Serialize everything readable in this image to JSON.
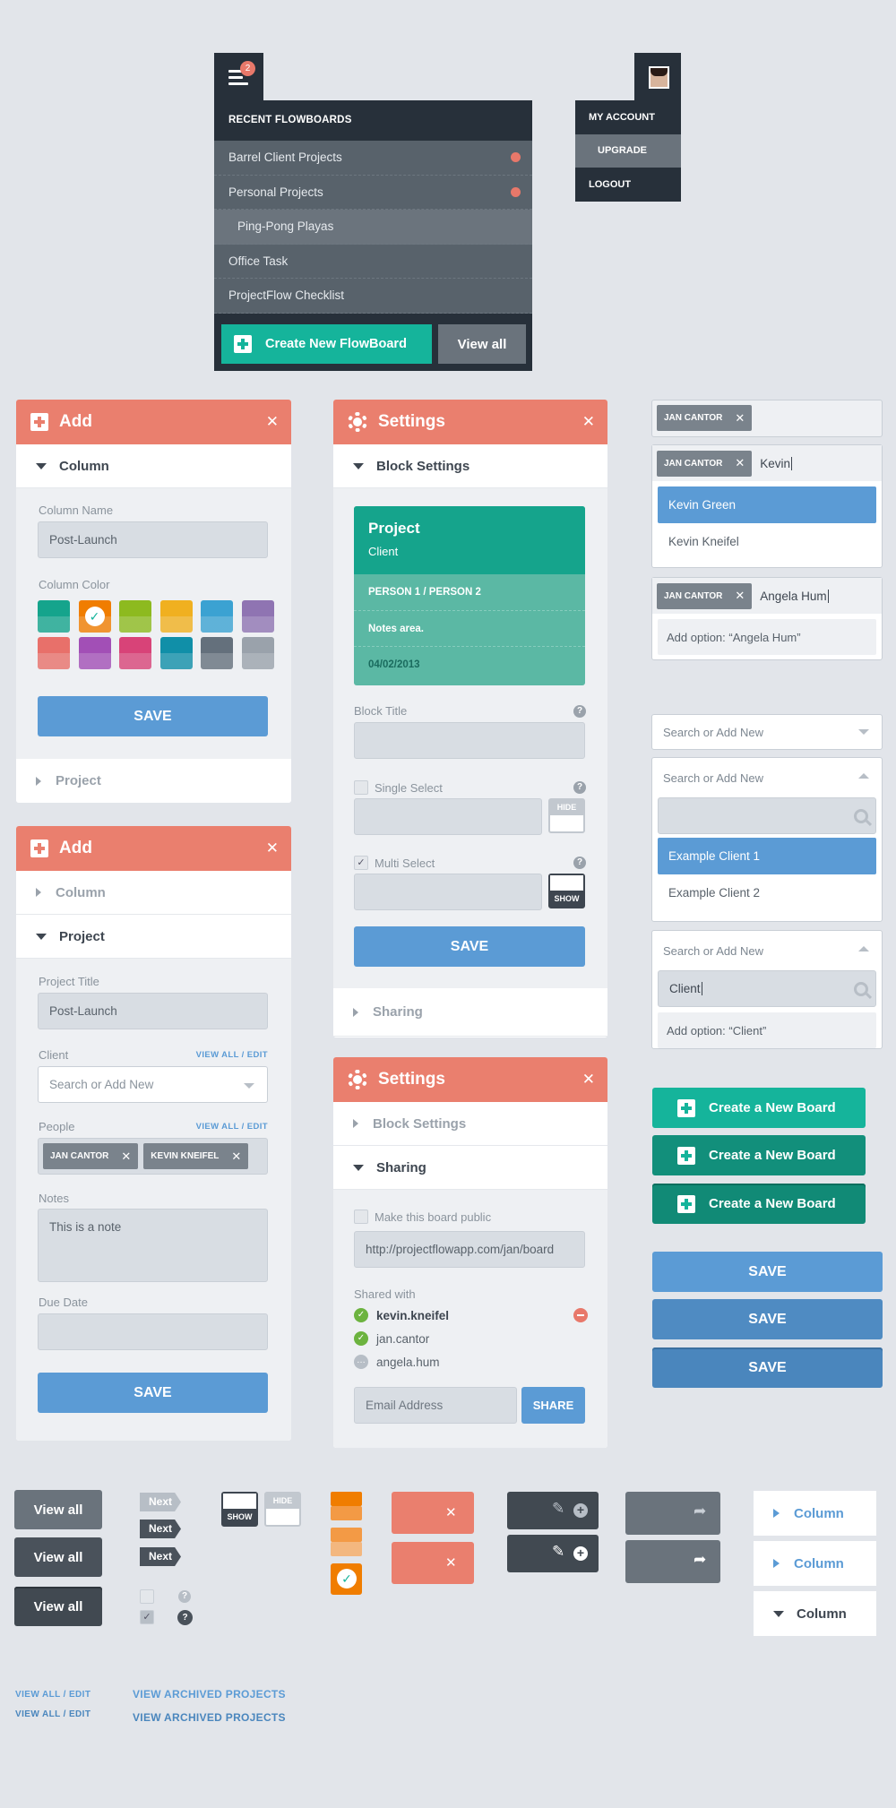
{
  "flowboards": {
    "badge_count": "2",
    "header": "RECENT FLOWBOARDS",
    "items": [
      "Barrel Client Projects",
      "Personal Projects",
      "Ping-Pong Playas",
      "Office Task",
      "ProjectFlow Checklist"
    ],
    "create_label": "Create New FlowBoard",
    "view_all_label": "View all"
  },
  "account_menu": {
    "items": [
      "MY ACCOUNT",
      "UPGRADE",
      "LOGOUT"
    ]
  },
  "add_panel_1": {
    "title": "Add",
    "section_open": "Column",
    "section_closed": "Project",
    "column_name_label": "Column Name",
    "column_name_value": "Post-Launch",
    "column_color_label": "Column Color",
    "save_label": "SAVE",
    "swatch_colors": [
      "#15a48c",
      "#f07d00",
      "#8dba1f",
      "#f0b020",
      "#3ba2d2",
      "#8f74b2",
      "#e8706a",
      "#a24fb6",
      "#d84378",
      "#108fa8",
      "#64707c",
      "#9aa2ab"
    ]
  },
  "add_panel_2": {
    "title": "Add",
    "section_closed": "Column",
    "section_open": "Project",
    "project_title_label": "Project Title",
    "project_title_value": "Post-Launch",
    "client_label": "Client",
    "client_link": "VIEW ALL / EDIT",
    "client_placeholder": "Search or Add New",
    "people_label": "People",
    "people_link": "VIEW ALL / EDIT",
    "people": [
      "JAN CANTOR",
      "KEVIN KNEIFEL"
    ],
    "notes_label": "Notes",
    "notes_value": "This is a note",
    "due_date_label": "Due Date",
    "save_label": "SAVE"
  },
  "settings_panel_1": {
    "title": "Settings",
    "section_open": "Block Settings",
    "section_closed": "Sharing",
    "card": {
      "title": "Project",
      "subtitle": "Client",
      "people": "PERSON 1 / PERSON 2",
      "notes": "Notes area.",
      "date": "04/02/2013"
    },
    "block_title_label": "Block Title",
    "single_select_label": "Single Select",
    "multi_select_label": "Multi Select",
    "hide_label": "HIDE",
    "show_label": "SHOW",
    "help": "?",
    "save_label": "SAVE"
  },
  "settings_panel_2": {
    "title": "Settings",
    "section_closed": "Block Settings",
    "section_open": "Sharing",
    "public_label": "Make this board public",
    "url_value": "http://projectflowapp.com/jan/board",
    "shared_with_label": "Shared with",
    "shared": [
      "kevin.kneifel",
      "jan.cantor",
      "angela.hum"
    ],
    "email_placeholder": "Email Address",
    "share_label": "SHARE"
  },
  "tag_inputs": {
    "tag": "JAN CANTOR",
    "typed_1": "Kevin",
    "options_1": [
      "Kevin Green",
      "Kevin Kneifel"
    ],
    "typed_2": "Angela Hum",
    "add_option_2": "Add option: “Angela Hum”"
  },
  "client_dropdowns": {
    "placeholder": "Search or Add New",
    "options": [
      "Example Client 1",
      "Example Client 2"
    ],
    "typed": "Client",
    "add_option": "Add option: “Client”"
  },
  "create_board_label": "Create a New Board",
  "save_label": "SAVE",
  "kit": {
    "view_all": "View all",
    "next": "Next",
    "show": "SHOW",
    "hide": "HIDE",
    "help": "?",
    "column": "Column",
    "view_all_edit": "VIEW ALL / EDIT",
    "view_archived": "VIEW ARCHIVED PROJECTS"
  },
  "colors": {
    "accent_red": "#ea7f6e",
    "teal": "#15b49b",
    "blue": "#5b9bd5",
    "dark": "#27303a"
  }
}
